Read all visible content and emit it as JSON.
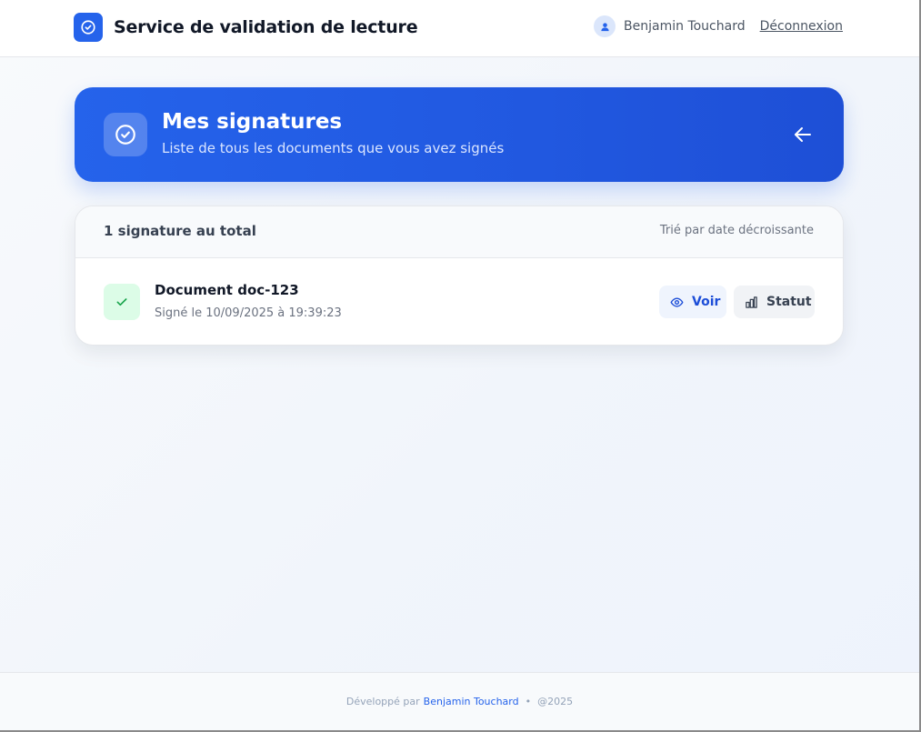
{
  "header": {
    "app_title": "Service de validation de lecture",
    "user_name": "Benjamin Touchard",
    "logout_label": "Déconnexion",
    "logo_icon": "check-circle-icon",
    "avatar_icon": "user-icon"
  },
  "hero": {
    "title": "Mes signatures",
    "subtitle": "Liste de tous les documents que vous avez signés",
    "icon": "check-circle-icon",
    "back_icon": "arrow-left-icon"
  },
  "list": {
    "count_label": "1 signature au total",
    "sort_label": "Trié par date décroissante",
    "items": [
      {
        "name": "Document doc-123",
        "signed_at": "Signé le 10/09/2025 à 19:39:23",
        "status_icon": "check-icon",
        "view_label": "Voir",
        "status_label": "Statut"
      }
    ]
  },
  "footer": {
    "prefix": "Développé par",
    "author": "Benjamin Touchard",
    "separator": "•",
    "year": "@2025"
  },
  "colors": {
    "accent": "#2563eb",
    "success_bg": "#dcfce7",
    "success": "#16a34a"
  }
}
